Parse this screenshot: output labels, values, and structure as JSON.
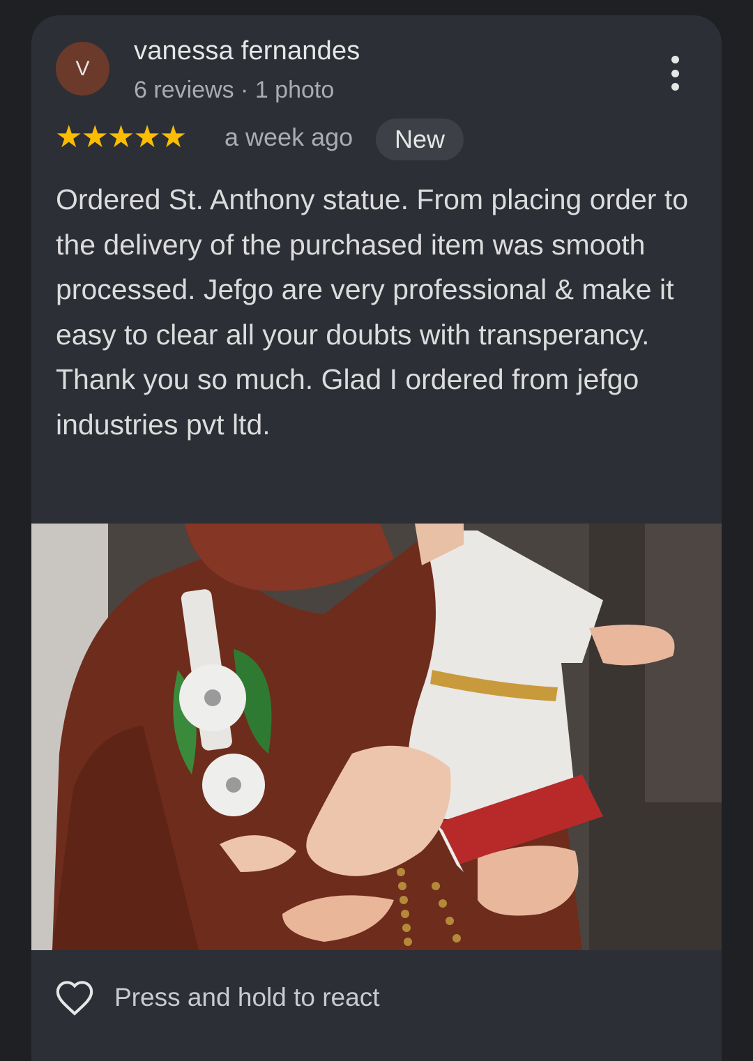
{
  "review": {
    "avatar_letter": "V",
    "reviewer_name": "vanessa fernandes",
    "reviewer_meta": "6 reviews · 1 photo",
    "rating": 5,
    "stars": "★★★★★",
    "time": "a week ago",
    "badge": "New",
    "text": "Ordered St. Anthony statue. From placing order to the delivery of the purchased item was smooth processed. Jefgo are very professional & make it easy to clear all your doubts with transperancy. Thank you so much. Glad I ordered from jefgo industries pvt ltd.",
    "menu_icon": "more-vert-icon",
    "photo_icon": "review-photo"
  },
  "footer": {
    "react_icon": "heart-outline-icon",
    "react_label": "Press and hold to react"
  },
  "colors": {
    "background": "#1f2024",
    "card": "#2c2f36",
    "star": "#fbbc04",
    "avatar": "#6b3a2a"
  }
}
